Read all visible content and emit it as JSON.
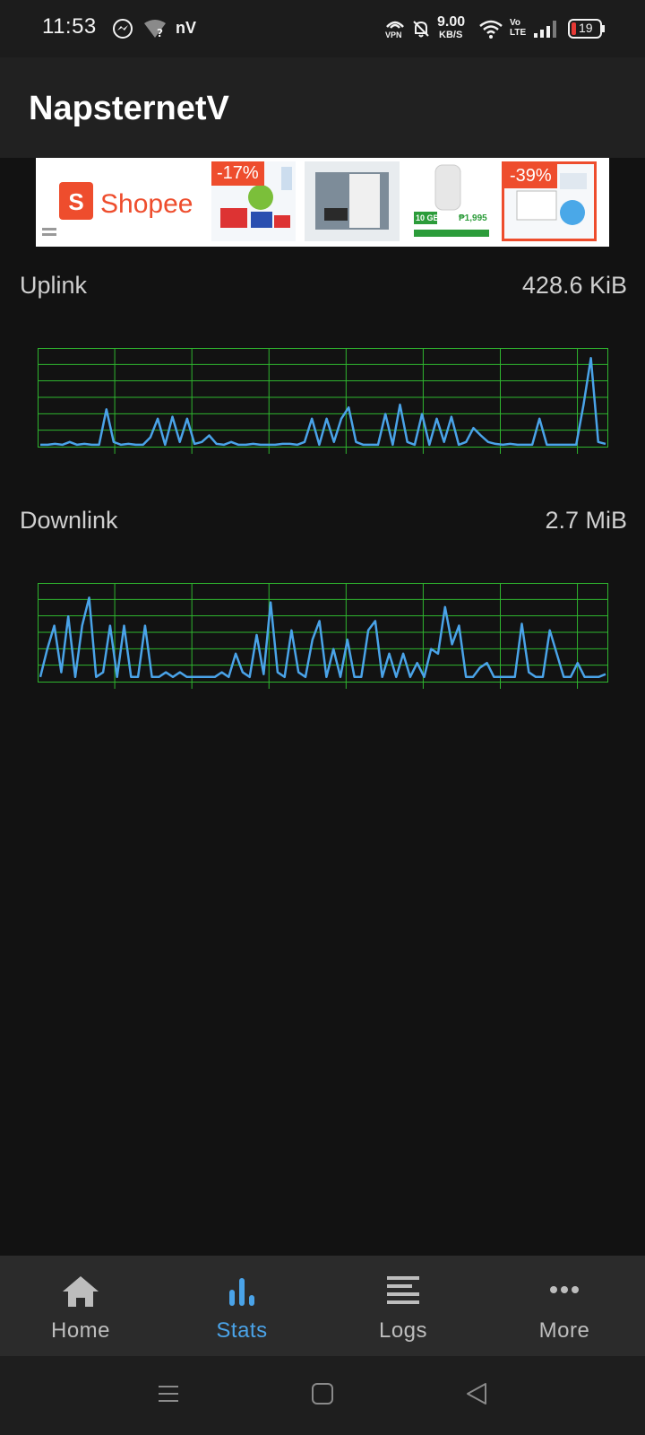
{
  "status_bar": {
    "time": "11:53",
    "app_badge": "nV",
    "net_speed_value": "9.00",
    "net_speed_unit": "KB/S",
    "vpn_label": "VPN",
    "volte_label": "Vo LTE",
    "battery": "19",
    "icons": [
      "messenger-icon",
      "wifi-question-icon",
      "vpn-icon",
      "mute-bell-icon",
      "wifi-icon",
      "signal-icon",
      "battery-icon"
    ]
  },
  "app": {
    "title": "NapsternetV"
  },
  "ad": {
    "brand": "Shopee",
    "brand_letter": "S",
    "brand_color": "#ee4d2d",
    "products": [
      {
        "discount": "-17%"
      },
      {
        "discount": ""
      },
      {
        "discount": ""
      },
      {
        "discount": "-39%"
      }
    ],
    "product_text": {
      "data": "10 GB",
      "price": "₱1,995"
    }
  },
  "stats": {
    "uplink": {
      "label": "Uplink",
      "value": "428.6 KiB"
    },
    "downlink": {
      "label": "Downlink",
      "value": "2.7 MiB"
    }
  },
  "chart_data": [
    {
      "type": "line",
      "title": "",
      "grid": true,
      "series": [
        {
          "values": [
            0.02,
            0.02,
            0.03,
            0.02,
            0.05,
            0.02,
            0.03,
            0.02,
            0.02,
            0.4,
            0.05,
            0.02,
            0.03,
            0.02,
            0.02,
            0.1,
            0.3,
            0.02,
            0.32,
            0.05,
            0.3,
            0.03,
            0.05,
            0.12,
            0.03,
            0.02,
            0.05,
            0.02,
            0.02,
            0.03,
            0.02,
            0.02,
            0.02,
            0.03,
            0.03,
            0.02,
            0.05,
            0.3,
            0.02,
            0.3,
            0.05,
            0.3,
            0.42,
            0.05,
            0.02,
            0.02,
            0.02,
            0.35,
            0.02,
            0.45,
            0.05,
            0.02,
            0.35,
            0.02,
            0.3,
            0.05,
            0.32,
            0.02,
            0.05,
            0.2,
            0.12,
            0.05,
            0.03,
            0.02,
            0.03,
            0.02,
            0.02,
            0.02,
            0.3,
            0.02,
            0.02,
            0.02,
            0.02,
            0.02,
            0.45,
            0.95,
            0.05,
            0.03
          ]
        }
      ],
      "colors": {
        "line": "#4aa3e8",
        "grid": "#2fb52f"
      }
    },
    {
      "type": "line",
      "title": "",
      "grid": true,
      "series": [
        {
          "values": [
            0.05,
            0.35,
            0.6,
            0.1,
            0.7,
            0.05,
            0.6,
            0.9,
            0.05,
            0.1,
            0.6,
            0.05,
            0.6,
            0.05,
            0.05,
            0.6,
            0.05,
            0.05,
            0.1,
            0.05,
            0.1,
            0.05,
            0.05,
            0.05,
            0.05,
            0.05,
            0.1,
            0.05,
            0.3,
            0.1,
            0.05,
            0.5,
            0.08,
            0.85,
            0.1,
            0.05,
            0.55,
            0.1,
            0.05,
            0.45,
            0.65,
            0.05,
            0.35,
            0.05,
            0.45,
            0.05,
            0.05,
            0.55,
            0.65,
            0.05,
            0.3,
            0.05,
            0.3,
            0.05,
            0.2,
            0.05,
            0.35,
            0.3,
            0.8,
            0.4,
            0.6,
            0.05,
            0.05,
            0.15,
            0.2,
            0.05,
            0.05,
            0.05,
            0.05,
            0.62,
            0.1,
            0.05,
            0.05,
            0.55,
            0.3,
            0.05,
            0.05,
            0.2,
            0.05,
            0.05,
            0.05,
            0.08
          ]
        }
      ],
      "colors": {
        "line": "#4aa3e8",
        "grid": "#2fb52f"
      }
    }
  ],
  "bottom_nav": {
    "items": [
      {
        "label": "Home",
        "icon": "home-icon"
      },
      {
        "label": "Stats",
        "icon": "stats-icon",
        "active": true
      },
      {
        "label": "Logs",
        "icon": "logs-icon"
      },
      {
        "label": "More",
        "icon": "more-icon"
      }
    ],
    "active_color": "#4aa3e8"
  },
  "system_nav": {
    "icons": [
      "recents-icon",
      "home-button-icon",
      "back-icon"
    ]
  }
}
